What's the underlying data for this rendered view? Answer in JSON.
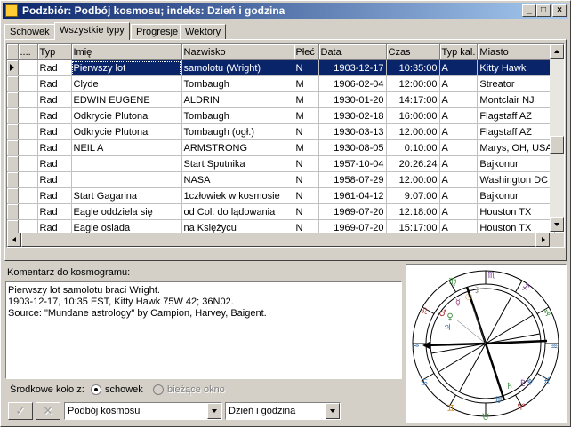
{
  "window": {
    "title": "Podzbiór: Podbój kosmosu;  indeks: Dzień i godzina",
    "minimize": "_",
    "maximize": "□",
    "close": "×"
  },
  "tabs": [
    {
      "label": "Schowek"
    },
    {
      "label": "Wszystkie typy",
      "active": true
    },
    {
      "label": "Progresje"
    },
    {
      "label": "Wektory"
    }
  ],
  "grid": {
    "columns": [
      "....",
      "Typ",
      "Imię",
      "Nazwisko",
      "Płeć",
      "Data",
      "Czas",
      "Typ kal.",
      "Miasto"
    ],
    "rows": [
      [
        "",
        "Rad",
        "Pierwszy  lot",
        "samolotu (Wright)",
        "N",
        "1903-12-17",
        "10:35:00",
        "A",
        "Kitty Hawk"
      ],
      [
        "",
        "Rad",
        "Clyde",
        "Tombaugh",
        "M",
        "1906-02-04",
        "12:00:00",
        "A",
        "Streator"
      ],
      [
        "",
        "Rad",
        "EDWIN EUGENE",
        "ALDRIN",
        "M",
        "1930-01-20",
        "14:17:00",
        "A",
        "Montclair NJ"
      ],
      [
        "",
        "Rad",
        "Odkrycie Plutona",
        "Tombaugh",
        "M",
        "1930-02-18",
        "16:00:00",
        "A",
        "Flagstaff AZ"
      ],
      [
        "",
        "Rad",
        "Odkrycie Plutona",
        "Tombaugh (ogł.)",
        "N",
        "1930-03-13",
        "12:00:00",
        "A",
        "Flagstaff AZ"
      ],
      [
        "",
        "Rad",
        "NEIL A",
        "ARMSTRONG",
        "M",
        "1930-08-05",
        "0:10:00",
        "A",
        "Marys, OH, USA"
      ],
      [
        "",
        "Rad",
        "",
        "Start Sputnika",
        "N",
        "1957-10-04",
        "20:26:24",
        "A",
        "Bajkonur"
      ],
      [
        "",
        "Rad",
        "",
        "NASA",
        "N",
        "1958-07-29",
        "12:00:00",
        "A",
        "Washington DC"
      ],
      [
        "",
        "Rad",
        "Start Gagarina",
        "1człowiek w kosmosie",
        "N",
        "1961-04-12",
        "9:07:00",
        "A",
        "Bajkonur"
      ],
      [
        "",
        "Rad",
        "Eagle oddziela się",
        "od Col. do lądowania",
        "N",
        "1969-07-20",
        "12:18:00",
        "A",
        "Houston TX"
      ],
      [
        "",
        "Rad",
        "Eagle osiada",
        "na Księżycu",
        "N",
        "1969-07-20",
        "15:17:00",
        "A",
        "Houston TX"
      ]
    ],
    "selected_row": 0
  },
  "comment": {
    "label": "Komentarz do kosmogramu:",
    "lines": [
      "Pierwszy lot samolotu braci Wright.",
      "1903-12-17, 10:35 EST, Kitty Hawk 75W 42; 36N02.",
      "Source: \"Mundane astrology\" by Campion, Harvey, Baigent."
    ]
  },
  "center_wheel": {
    "label": "Środkowe koło z:",
    "option_clipboard": "schowek",
    "option_current": "bieżące okno",
    "selected": "schowek"
  },
  "bottom": {
    "ok_glyph": "✓",
    "cancel_glyph": "✕",
    "subset_value": "Podbój kosmosu",
    "index_value": "Dzień i godzina"
  },
  "icons": {
    "title_icon": "app-icon",
    "row_pointer": "row-pointer-icon"
  }
}
